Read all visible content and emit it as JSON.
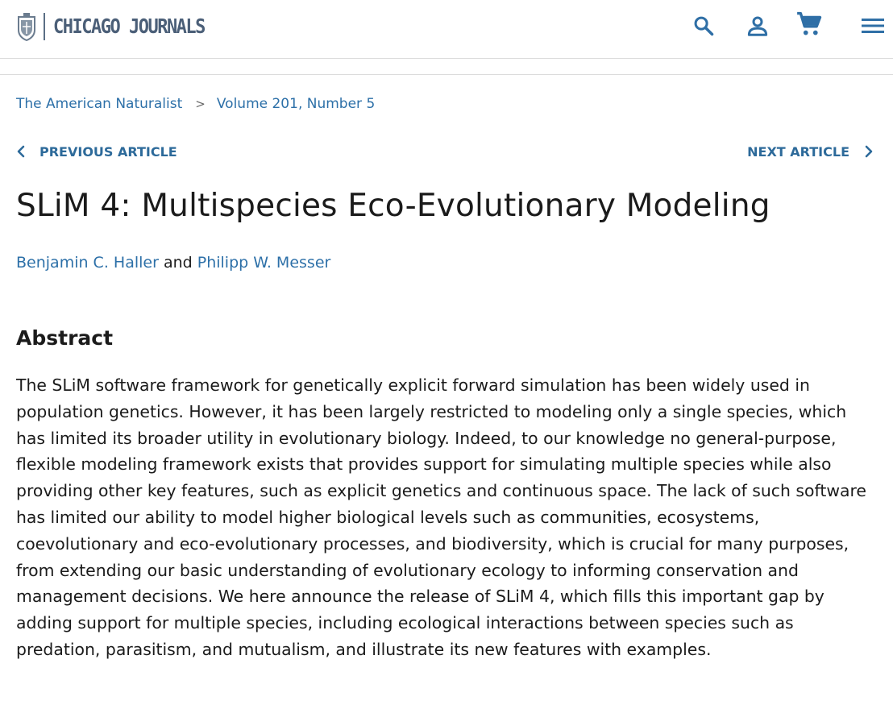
{
  "header": {
    "logo_text": "CHICAGO JOURNALS",
    "icons": [
      "university-seal",
      "search-icon",
      "account-icon",
      "cart-icon",
      "menu-icon"
    ]
  },
  "breadcrumb": {
    "journal": "The American Naturalist",
    "separator": ">",
    "issue": "Volume 201, Number 5"
  },
  "article_nav": {
    "previous_label": "PREVIOUS ARTICLE",
    "next_label": "NEXT ARTICLE"
  },
  "article": {
    "title": "SLiM 4: Multispecies Eco-Evolutionary Modeling",
    "authors": [
      {
        "name": "Benjamin C. Haller"
      },
      {
        "name": "Philipp W. Messer"
      }
    ],
    "author_conjunction": "and",
    "abstract_heading": "Abstract",
    "abstract_text": "The SLiM software framework for genetically explicit forward simulation has been widely used in population genetics. However, it has been largely restricted to modeling only a single species, which has limited its broader utility in evolutionary biology. Indeed, to our knowledge no general-purpose, flexible modeling framework exists that provides support for simulating multiple species while also providing other key features, such as explicit genetics and continuous space. The lack of such software has limited our ability to model higher biological levels such as communities, ecosystems, coevolutionary and eco-evolutionary processes, and biodiversity, which is crucial for many purposes, from extending our basic understanding of evolutionary ecology to informing conservation and management decisions. We here announce the release of SLiM 4, which fills this important gap by adding support for multiple species, including ecological interactions between species such as predation, parasitism, and mutualism, and illustrate its new features with examples."
  },
  "colors": {
    "link": "#2d70a8",
    "nav_link": "#2d6a9a",
    "logo": "#4b5f78",
    "icon": "#2f6fa6",
    "text": "#1b1b1b"
  }
}
